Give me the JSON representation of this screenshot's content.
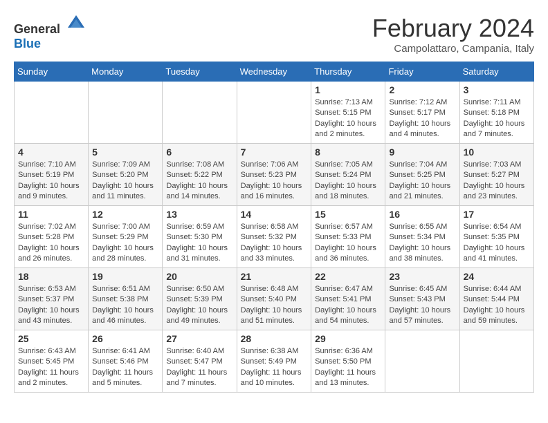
{
  "logo": {
    "general": "General",
    "blue": "Blue"
  },
  "header": {
    "title": "February 2024",
    "subtitle": "Campolattaro, Campania, Italy"
  },
  "weekdays": [
    "Sunday",
    "Monday",
    "Tuesday",
    "Wednesday",
    "Thursday",
    "Friday",
    "Saturday"
  ],
  "weeks": [
    [
      {
        "day": "",
        "detail": ""
      },
      {
        "day": "",
        "detail": ""
      },
      {
        "day": "",
        "detail": ""
      },
      {
        "day": "",
        "detail": ""
      },
      {
        "day": "1",
        "detail": "Sunrise: 7:13 AM\nSunset: 5:15 PM\nDaylight: 10 hours\nand 2 minutes."
      },
      {
        "day": "2",
        "detail": "Sunrise: 7:12 AM\nSunset: 5:17 PM\nDaylight: 10 hours\nand 4 minutes."
      },
      {
        "day": "3",
        "detail": "Sunrise: 7:11 AM\nSunset: 5:18 PM\nDaylight: 10 hours\nand 7 minutes."
      }
    ],
    [
      {
        "day": "4",
        "detail": "Sunrise: 7:10 AM\nSunset: 5:19 PM\nDaylight: 10 hours\nand 9 minutes."
      },
      {
        "day": "5",
        "detail": "Sunrise: 7:09 AM\nSunset: 5:20 PM\nDaylight: 10 hours\nand 11 minutes."
      },
      {
        "day": "6",
        "detail": "Sunrise: 7:08 AM\nSunset: 5:22 PM\nDaylight: 10 hours\nand 14 minutes."
      },
      {
        "day": "7",
        "detail": "Sunrise: 7:06 AM\nSunset: 5:23 PM\nDaylight: 10 hours\nand 16 minutes."
      },
      {
        "day": "8",
        "detail": "Sunrise: 7:05 AM\nSunset: 5:24 PM\nDaylight: 10 hours\nand 18 minutes."
      },
      {
        "day": "9",
        "detail": "Sunrise: 7:04 AM\nSunset: 5:25 PM\nDaylight: 10 hours\nand 21 minutes."
      },
      {
        "day": "10",
        "detail": "Sunrise: 7:03 AM\nSunset: 5:27 PM\nDaylight: 10 hours\nand 23 minutes."
      }
    ],
    [
      {
        "day": "11",
        "detail": "Sunrise: 7:02 AM\nSunset: 5:28 PM\nDaylight: 10 hours\nand 26 minutes."
      },
      {
        "day": "12",
        "detail": "Sunrise: 7:00 AM\nSunset: 5:29 PM\nDaylight: 10 hours\nand 28 minutes."
      },
      {
        "day": "13",
        "detail": "Sunrise: 6:59 AM\nSunset: 5:30 PM\nDaylight: 10 hours\nand 31 minutes."
      },
      {
        "day": "14",
        "detail": "Sunrise: 6:58 AM\nSunset: 5:32 PM\nDaylight: 10 hours\nand 33 minutes."
      },
      {
        "day": "15",
        "detail": "Sunrise: 6:57 AM\nSunset: 5:33 PM\nDaylight: 10 hours\nand 36 minutes."
      },
      {
        "day": "16",
        "detail": "Sunrise: 6:55 AM\nSunset: 5:34 PM\nDaylight: 10 hours\nand 38 minutes."
      },
      {
        "day": "17",
        "detail": "Sunrise: 6:54 AM\nSunset: 5:35 PM\nDaylight: 10 hours\nand 41 minutes."
      }
    ],
    [
      {
        "day": "18",
        "detail": "Sunrise: 6:53 AM\nSunset: 5:37 PM\nDaylight: 10 hours\nand 43 minutes."
      },
      {
        "day": "19",
        "detail": "Sunrise: 6:51 AM\nSunset: 5:38 PM\nDaylight: 10 hours\nand 46 minutes."
      },
      {
        "day": "20",
        "detail": "Sunrise: 6:50 AM\nSunset: 5:39 PM\nDaylight: 10 hours\nand 49 minutes."
      },
      {
        "day": "21",
        "detail": "Sunrise: 6:48 AM\nSunset: 5:40 PM\nDaylight: 10 hours\nand 51 minutes."
      },
      {
        "day": "22",
        "detail": "Sunrise: 6:47 AM\nSunset: 5:41 PM\nDaylight: 10 hours\nand 54 minutes."
      },
      {
        "day": "23",
        "detail": "Sunrise: 6:45 AM\nSunset: 5:43 PM\nDaylight: 10 hours\nand 57 minutes."
      },
      {
        "day": "24",
        "detail": "Sunrise: 6:44 AM\nSunset: 5:44 PM\nDaylight: 10 hours\nand 59 minutes."
      }
    ],
    [
      {
        "day": "25",
        "detail": "Sunrise: 6:43 AM\nSunset: 5:45 PM\nDaylight: 11 hours\nand 2 minutes."
      },
      {
        "day": "26",
        "detail": "Sunrise: 6:41 AM\nSunset: 5:46 PM\nDaylight: 11 hours\nand 5 minutes."
      },
      {
        "day": "27",
        "detail": "Sunrise: 6:40 AM\nSunset: 5:47 PM\nDaylight: 11 hours\nand 7 minutes."
      },
      {
        "day": "28",
        "detail": "Sunrise: 6:38 AM\nSunset: 5:49 PM\nDaylight: 11 hours\nand 10 minutes."
      },
      {
        "day": "29",
        "detail": "Sunrise: 6:36 AM\nSunset: 5:50 PM\nDaylight: 11 hours\nand 13 minutes."
      },
      {
        "day": "",
        "detail": ""
      },
      {
        "day": "",
        "detail": ""
      }
    ]
  ]
}
